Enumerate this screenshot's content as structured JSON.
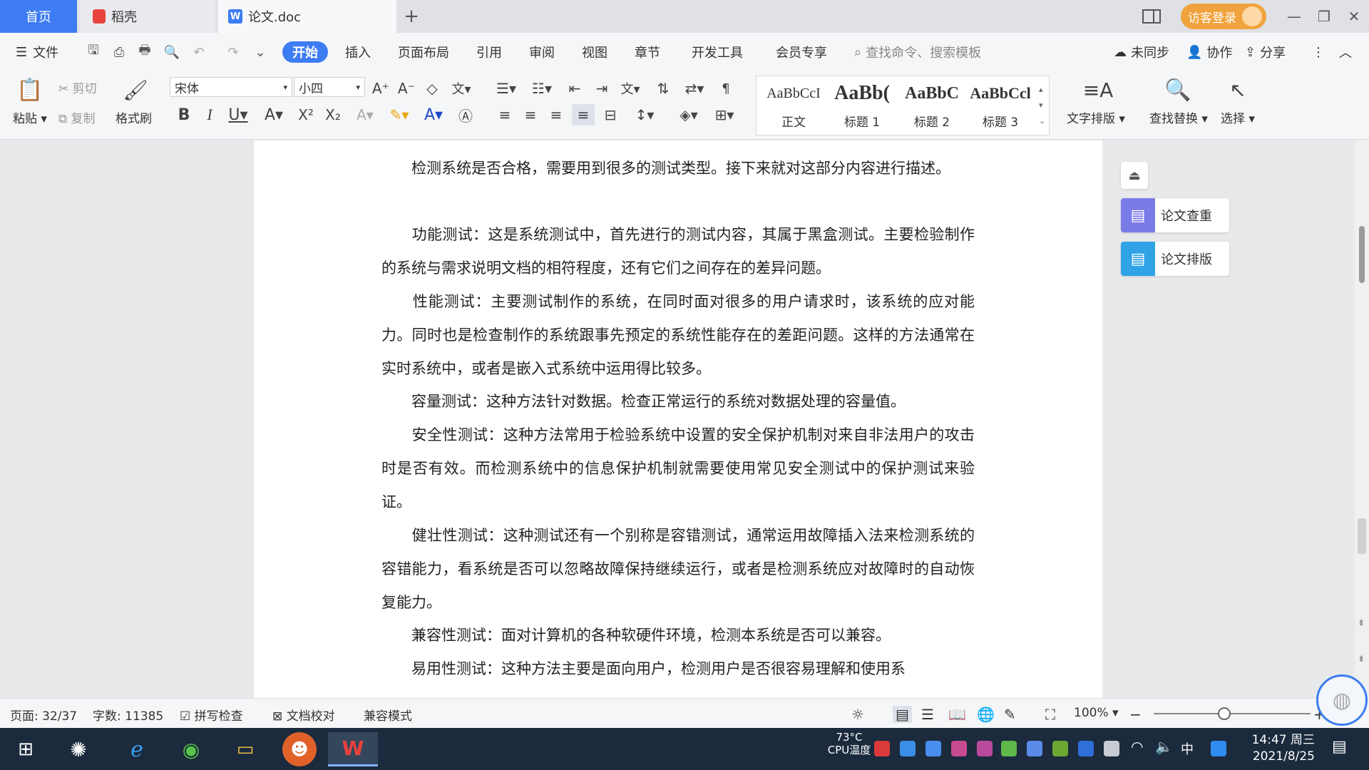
{
  "titlebar": {
    "tabs": [
      {
        "label": "首页"
      },
      {
        "label": "稻壳"
      },
      {
        "label": "论文.doc"
      }
    ],
    "new_tab": "+",
    "login": "访客登录"
  },
  "menubar": {
    "file": "文件",
    "items": [
      "开始",
      "插入",
      "页面布局",
      "引用",
      "审阅",
      "视图",
      "章节",
      "开发工具",
      "会员专享"
    ],
    "search_placeholder": "查找命令、搜索模板",
    "sync": "未同步",
    "collab": "协作",
    "share": "分享"
  },
  "ribbon": {
    "paste": "粘贴",
    "cut": "剪切",
    "copy": "复制",
    "format_painter": "格式刷",
    "font": "宋体",
    "size": "小四",
    "styles": [
      {
        "preview": "AaBbCcI",
        "name": "正文"
      },
      {
        "preview": "AaBb(",
        "name": "标题 1"
      },
      {
        "preview": "AaBbC",
        "name": "标题 2"
      },
      {
        "preview": "AaBbCcl",
        "name": "标题 3"
      }
    ],
    "text_layout": "文字排版",
    "find_replace": "查找替换",
    "select": "选择"
  },
  "document": {
    "paragraphs": [
      "　　检测系统是否合格，需要用到很多的测试类型。接下来就对这部分内容进行描述。",
      "　　功能测试：这是系统测试中，首先进行的测试内容，其属于黑盒测试。主要检验制作的系统与需求说明文档的相符程度，还有它们之间存在的差异问题。",
      "　　性能测试：主要测试制作的系统，在同时面对很多的用户请求时，该系统的应对能力。同时也是检查制作的系统跟事先预定的系统性能存在的差距问题。这样的方法通常在实时系统中，或者是嵌入式系统中运用得比较多。",
      "　　容量测试：这种方法针对数据。检查正常运行的系统对数据处理的容量值。",
      "　　安全性测试：这种方法常用于检验系统中设置的安全保护机制对来自非法用户的攻击时是否有效。而检测系统中的信息保护机制就需要使用常见安全测试中的保护测试来验证。",
      "　　健壮性测试：这种测试还有一个别称是容错测试，通常运用故障插入法来检测系统的容错能力，看系统是否可以忽略故障保持继续运行，或者是检测系统应对故障时的自动恢复能力。",
      "　　兼容性测试：面对计算机的各种软硬件环境，检测本系统是否可以兼容。",
      "　　易用性测试：这种方法主要是面向用户，检测用户是否很容易理解和使用系"
    ]
  },
  "sidepanel": {
    "check": "论文查重",
    "layout": "论文排版"
  },
  "statusbar": {
    "page": "页面: 32/37",
    "words": "字数: 11385",
    "spell": "拼写检查",
    "proof": "文档校对",
    "compat": "兼容模式",
    "zoom": "100%"
  },
  "taskbar": {
    "temp": "73°C",
    "cpu": "CPU温度",
    "ime": "中",
    "time": "14:47 周三",
    "date": "2021/8/25"
  },
  "colors": {
    "accent": "#3d7cf3",
    "login": "#f0a23c",
    "taskbar": "#1b2a3d"
  }
}
